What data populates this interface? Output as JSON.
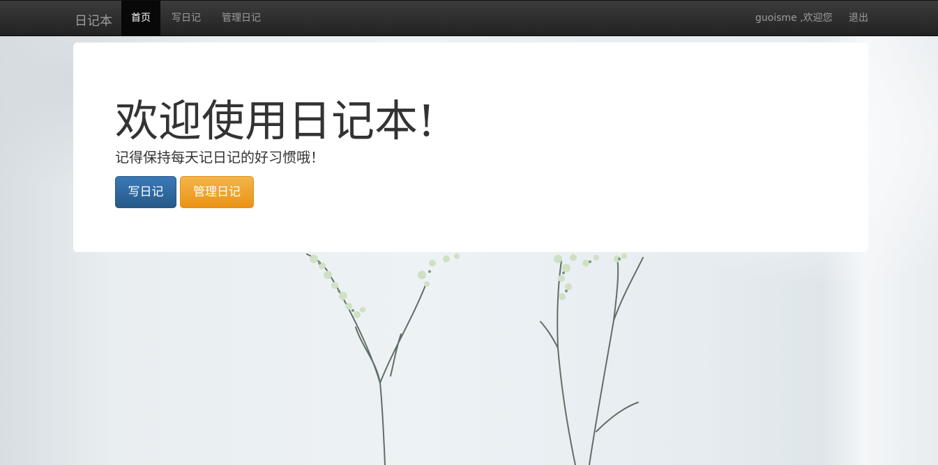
{
  "navbar": {
    "brand": "日记本",
    "items": [
      {
        "label": "首页",
        "active": true
      },
      {
        "label": "写日记",
        "active": false
      },
      {
        "label": "管理日记",
        "active": false
      }
    ],
    "user_greeting": "guoisme ,欢迎您",
    "logout": "退出"
  },
  "jumbotron": {
    "title": "欢迎使用日记本!",
    "subtitle": "记得保持每天记日记的好习惯哦！",
    "primary_button": "写日记",
    "warning_button": "管理日记"
  },
  "colors": {
    "navbar_bg": "#222222",
    "nav_text": "#9d9d9d",
    "primary": "#265a88",
    "warning": "#eb9316"
  }
}
